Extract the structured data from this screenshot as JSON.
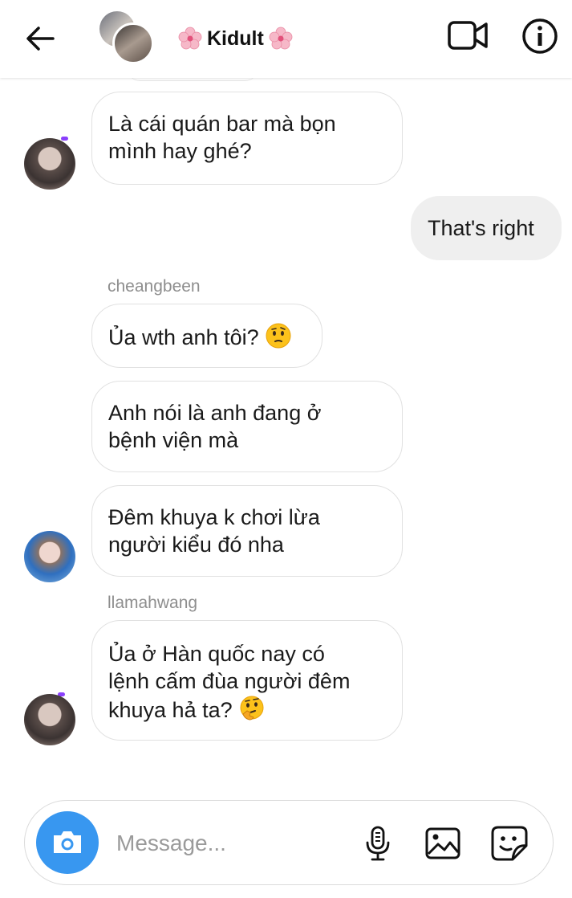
{
  "header": {
    "title": "Kidult",
    "back_icon": "arrow-left-icon",
    "video_icon": "video-camera-icon",
    "info_icon": "info-icon"
  },
  "messages": [
    {
      "from": "other",
      "avatar": "a",
      "text_line1": "Là cái quán bar mà bọn",
      "text_line2": "mình hay ghé?"
    },
    {
      "from": "self",
      "text": "That's right"
    },
    {
      "sender": "cheangbeen",
      "text": "Ủa wth anh tôi?",
      "emoji": "thinking-face-icon"
    },
    {
      "text_line1": "Anh nói là anh đang ở",
      "text_line2": "bệnh viện mà"
    },
    {
      "text_line1": "Đêm khuya k chơi lừa",
      "text_line2": "người kiểu đó nha",
      "avatar": "b"
    },
    {
      "sender": "llamahwang",
      "text_line1": "Ủa ở Hàn quốc nay có",
      "text_line2": "lệnh cấm đùa người đêm",
      "text_line3": "khuya hả ta?",
      "emoji": "thinking-hand-face-icon",
      "avatar": "a"
    }
  ],
  "composer": {
    "placeholder": "Message...",
    "camera_icon": "camera-icon",
    "mic_icon": "microphone-icon",
    "gallery_icon": "image-icon",
    "sticker_icon": "sticker-icon",
    "accent_color": "#3897f0"
  }
}
